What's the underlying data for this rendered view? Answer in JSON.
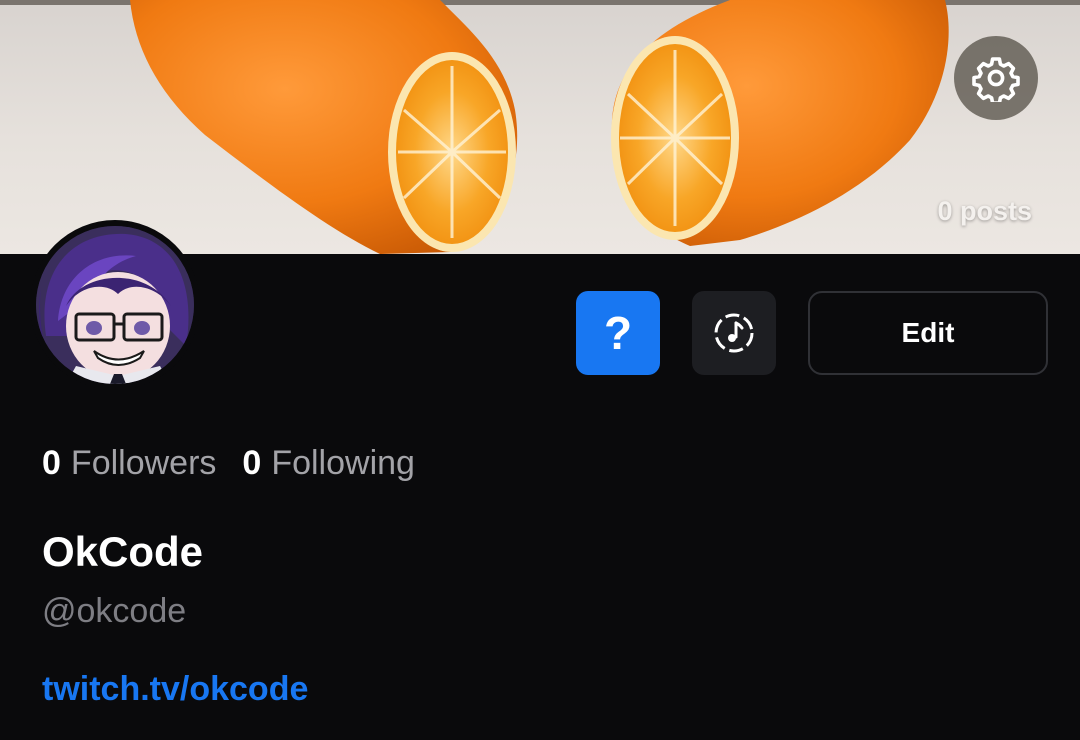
{
  "banner": {
    "image": "orange-halves-banner",
    "posts_label": "0 posts"
  },
  "icons": {
    "settings": "gear-icon",
    "help": "question-icon",
    "music": "music-note-icon"
  },
  "actions": {
    "help_label": "?",
    "edit_label": "Edit"
  },
  "stats": {
    "followers_count": "0",
    "followers_label": "Followers",
    "following_count": "0",
    "following_label": "Following"
  },
  "profile": {
    "display_name": "OkCode",
    "handle": "@okcode",
    "link": "twitch.tv/okcode"
  },
  "colors": {
    "background": "#0a0a0c",
    "accent": "#1877f2",
    "secondary_button": "#1d1e22",
    "muted_text": "#a3a3a8"
  }
}
